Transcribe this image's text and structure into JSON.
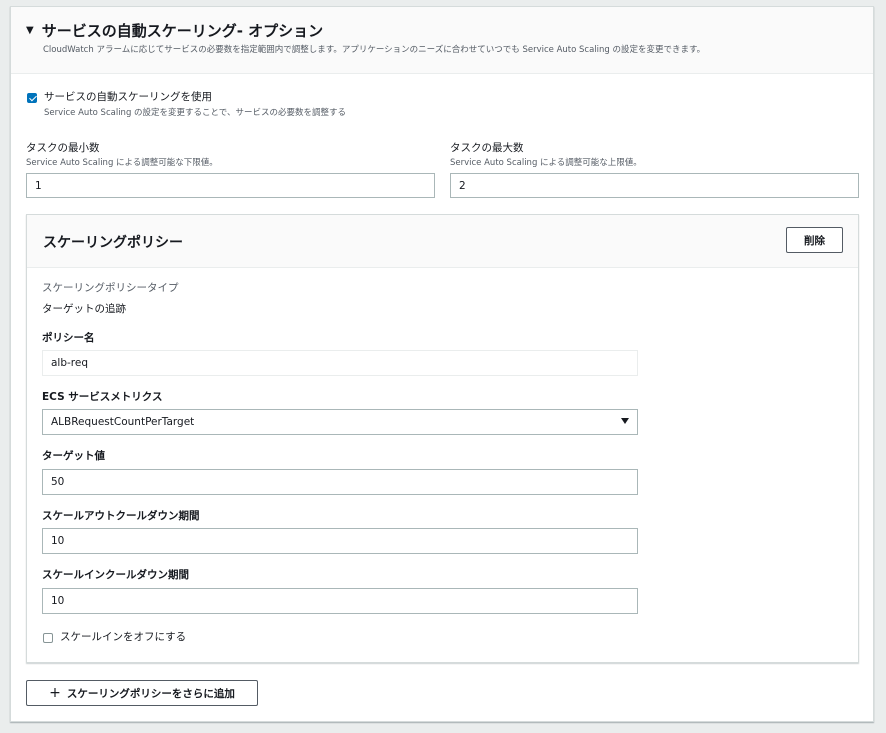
{
  "section": {
    "title": "サービスの自動スケーリング- オプション",
    "description": "CloudWatch アラームに応じてサービスの必要数を指定範囲内で調整します。アプリケーションのニーズに合わせていつでも Service Auto Scaling の設定を変更できます。"
  },
  "use_autoscaling": {
    "checked": true,
    "label": "サービスの自動スケーリングを使用",
    "hint": "Service Auto Scaling の設定を変更することで、サービスの必要数を調整する"
  },
  "min_tasks": {
    "label": "タスクの最小数",
    "hint": "Service Auto Scaling による調整可能な下限値。",
    "value": "1"
  },
  "max_tasks": {
    "label": "タスクの最大数",
    "hint": "Service Auto Scaling による調整可能な上限値。",
    "value": "2"
  },
  "policy": {
    "title": "スケーリングポリシー",
    "delete_label": "削除",
    "type_label": "スケーリングポリシータイプ",
    "type_value": "ターゲットの追跡",
    "name_label": "ポリシー名",
    "name_value": "alb-req",
    "metric_label": "ECS サービスメトリクス",
    "metric_value": "ALBRequestCountPerTarget",
    "target_label": "ターゲット値",
    "target_value": "50",
    "scale_out_label": "スケールアウトクールダウン期間",
    "scale_out_value": "10",
    "scale_in_label": "スケールインクールダウン期間",
    "scale_in_value": "10",
    "disable_scale_in_label": "スケールインをオフにする",
    "disable_scale_in_checked": false
  },
  "add_policy_label": "スケーリングポリシーをさらに追加",
  "icons": {
    "caret": "caret-down-icon",
    "select_arrow": "dropdown-arrow-icon",
    "plus": "plus-icon"
  },
  "colors": {
    "accent": "#0073bb",
    "text": "#16191f",
    "muted": "#545b64"
  }
}
